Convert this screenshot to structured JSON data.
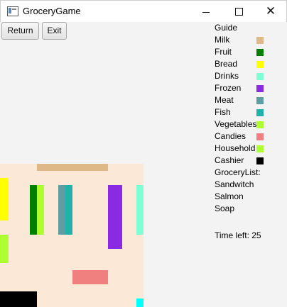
{
  "window": {
    "title": "GroceryGame",
    "minimize": "—",
    "maximize": "☐",
    "close": "✕"
  },
  "toolbar": {
    "return_label": "Return",
    "exit_label": "Exit"
  },
  "guide": {
    "heading": "Guide",
    "items": [
      {
        "label": "Milk",
        "color": "#deb887"
      },
      {
        "label": "Fruit",
        "color": "#008000"
      },
      {
        "label": "Bread",
        "color": "#ffff00"
      },
      {
        "label": "Drinks",
        "color": "#7fffd4"
      },
      {
        "label": "Frozen",
        "color": "#8a2be2"
      },
      {
        "label": "Meat",
        "color": "#5f9ea0"
      },
      {
        "label": "Fish",
        "color": "#20b2aa"
      },
      {
        "label": "Vegetables",
        "color": "#adff2f"
      },
      {
        "label": "Candies",
        "color": "#f08080"
      },
      {
        "label": "Household",
        "color": "#adff2f"
      },
      {
        "label": "Cashier",
        "color": "#000000"
      }
    ]
  },
  "grocery_list": {
    "heading": "GroceryList:",
    "items": [
      "Sandwitch",
      "Salmon",
      "Soap"
    ]
  },
  "timer": {
    "text": "Time left: 25"
  },
  "store_colors": {
    "floor": "#fbe8d6",
    "milk": "#deb887",
    "fruit": "#008000",
    "bread": "#ffff00",
    "drinks": "#7fffd4",
    "frozen": "#8a2be2",
    "meat": "#5f9ea0",
    "fish": "#20b2aa",
    "vegetables": "#adff2f",
    "candies": "#f08080",
    "household": "#adff2f",
    "cashier": "#000000",
    "exit": "#00ffff"
  }
}
